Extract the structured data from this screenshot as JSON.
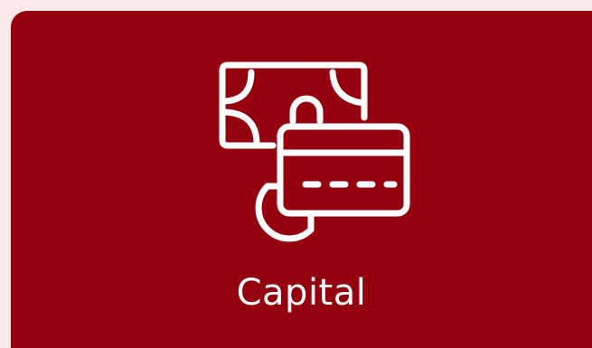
{
  "tile": {
    "label": "Capital",
    "icon": "money-and-card-icon"
  },
  "colors": {
    "page_background": "#fbe9e9",
    "tile_background": "#95000e",
    "foreground": "#ffffff"
  }
}
